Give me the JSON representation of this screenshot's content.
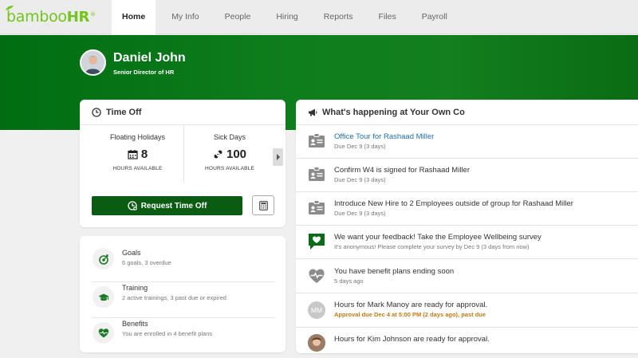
{
  "brand": {
    "logo_text": "bamboo",
    "logo_suffix": "HR",
    "logo_mark": "®",
    "color": "#73c41d"
  },
  "nav": [
    {
      "label": "Home",
      "active": true
    },
    {
      "label": "My Info"
    },
    {
      "label": "People"
    },
    {
      "label": "Hiring"
    },
    {
      "label": "Reports"
    },
    {
      "label": "Files"
    },
    {
      "label": "Payroll"
    }
  ],
  "profile": {
    "name": "Daniel John",
    "title": "Senior Director of HR"
  },
  "time_off": {
    "heading": "Time Off",
    "balances": [
      {
        "label": "Floating Holidays",
        "value": "8",
        "unit": "HOURS AVAILABLE",
        "icon": "calendar-icon"
      },
      {
        "label": "Sick Days",
        "value": "100",
        "unit": "HOURS AVAILABLE",
        "icon": "bandage-icon"
      }
    ],
    "request_label": "Request Time Off"
  },
  "goals_card": [
    {
      "title": "Goals",
      "subtitle": "6 goals, 3 overdue",
      "icon": "goal-icon"
    },
    {
      "title": "Training",
      "subtitle": "2 active trainings, 3 past due or expired",
      "icon": "graduation-cap-icon"
    },
    {
      "title": "Benefits",
      "subtitle": "You are enrolled in 4 benefit plans",
      "icon": "heart-pulse-icon"
    }
  ],
  "happening": {
    "heading": "What's happening at Your Own Co",
    "items": [
      {
        "title": "Office Tour for Rashaad Miller",
        "subtitle": "Due Dec 9 (3 days)",
        "icon": "id-card-icon"
      },
      {
        "title": "Confirm W4 is signed for Rashaad Miller",
        "subtitle": "Due Dec 9 (3 days)",
        "icon": "id-card-icon"
      },
      {
        "title": "Introduce New Hire to 2 Employees outside of group for Rashaad Miller",
        "subtitle": "Due Dec 9 (3 days)",
        "icon": "id-card-icon"
      },
      {
        "title": "We want your feedback! Take the Employee Wellbeing survey",
        "subtitle": "It's anonymous! Please complete your survey by Dec 9 (3 days from now)",
        "icon": "heart-chat-icon"
      },
      {
        "title": "You have benefit plans ending soon",
        "subtitle": "5 days ago",
        "icon": "heart-pulse-icon"
      },
      {
        "title": "Hours for Mark Manoy are ready for approval.",
        "subtitle": "Approval due Dec 4 at 5:00 PM (2 days ago), past due",
        "avatar_initials": "MM"
      },
      {
        "title": "Hours for Kim Johnson are ready for approval.",
        "subtitle": ""
      }
    ]
  }
}
